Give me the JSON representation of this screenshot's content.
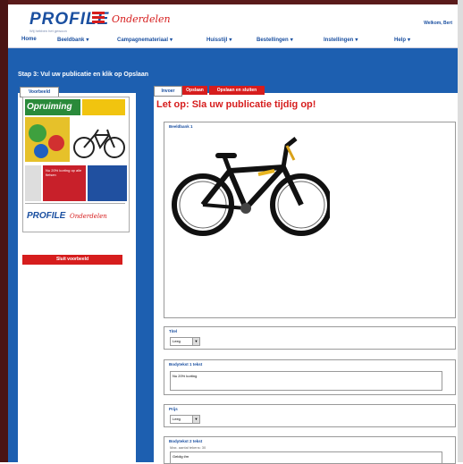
{
  "brand": {
    "logo": "PROFILE",
    "tagline": "Wij hebben het gewoon",
    "script": "Onderdelen",
    "colors": {
      "primary": "#1d5fb0",
      "accent": "#d61d1d"
    }
  },
  "header": {
    "greeting": "Welkom, Bert",
    "greeting_is_partial": true
  },
  "nav": {
    "items": [
      {
        "label": "Home",
        "has_menu": false
      },
      {
        "label": "Beeldbank",
        "has_menu": true
      },
      {
        "label": "Campagnemateriaal",
        "has_menu": true
      },
      {
        "label": "Huisstijl",
        "has_menu": true
      },
      {
        "label": "Bestellingen",
        "has_menu": true
      },
      {
        "label": "Instellingen",
        "has_menu": true
      },
      {
        "label": "Help",
        "has_menu": true
      }
    ],
    "chevron": "▾"
  },
  "step": {
    "text": "Stap 3: Vul uw publicatie en klik op Opslaan"
  },
  "left_panel": {
    "tab": "Voorbeeld",
    "thumbnail": {
      "headline": "Opruiming",
      "red_block_text": "Nu 20% korting op alle fietsen",
      "footer_logo": "PROFILE",
      "footer_script": "Onderdelen"
    },
    "delete_button": "Sluit voorbeeld"
  },
  "right_panel": {
    "tabs": [
      {
        "label": "Invoer",
        "active": true
      },
      {
        "label": "Opslaan",
        "active": false
      },
      {
        "label": "Opslaan en sluiten",
        "active": false
      }
    ],
    "notice": "Let op: Sla uw publicatie tijdig op!",
    "image_field": {
      "label": "Beeldbank 1"
    },
    "field1": {
      "label": "Titel",
      "value": "Leeg"
    },
    "field2": {
      "label": "Bodytekst 1 tekst",
      "value": "Nu 20% korting"
    },
    "field3": {
      "label": "Prijs",
      "value": "Leeg"
    },
    "field4": {
      "label": "Bodytekst 2 tekst",
      "hint": "Max. aantal tekens: 30",
      "value": "Geldig t/m"
    }
  },
  "icons": {
    "select_arrow": "arrow-down-icon"
  }
}
